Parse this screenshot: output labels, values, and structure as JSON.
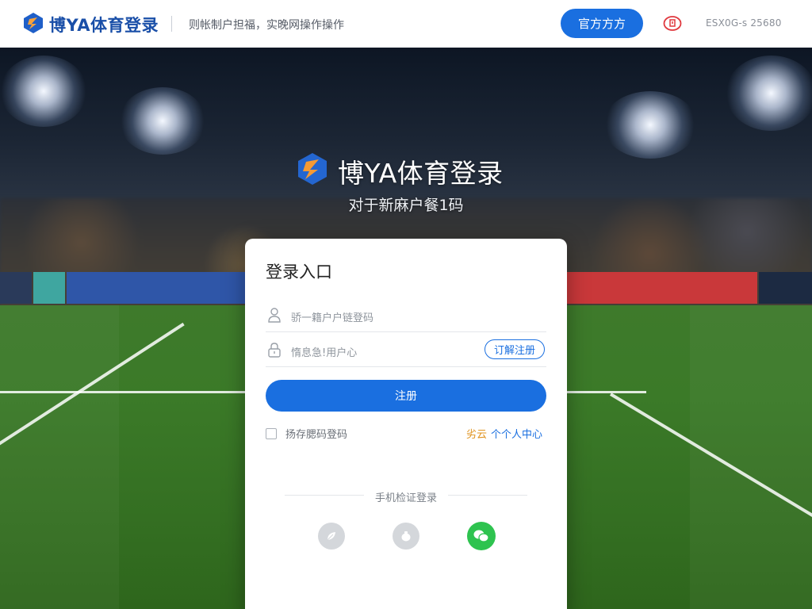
{
  "header": {
    "brand": "博YA体育登录",
    "tagline": "则帐制户担福，实晚网操作操作",
    "official_button": "官方方方",
    "meta_text": "ESX0G-s 25680"
  },
  "hero": {
    "title": "博YA体育登录",
    "subtitle": "对于新麻户餐1码"
  },
  "login": {
    "title": "登录入口",
    "account_placeholder": "骄一籍户户链登码",
    "code_placeholder": "惰息急!用户心",
    "sms_button": "订解注册",
    "submit_button": "注册",
    "remember_label": "扬存腮码登码",
    "forgot_prefix": "劣云",
    "forgot_link": "个个人中心",
    "alt_login_label": "手机检证登录"
  },
  "social_logins": [
    {
      "icon": "leaf-icon",
      "color": "#b8bcc2"
    },
    {
      "icon": "bag-icon",
      "color": "#b8bcc2"
    },
    {
      "icon": "wechat-icon",
      "color": "#2ec34f"
    }
  ],
  "colors": {
    "accent": "#1a6fe0",
    "brand": "#1a4fa8",
    "link_orange": "#e09420",
    "alert": "#e0383e"
  }
}
